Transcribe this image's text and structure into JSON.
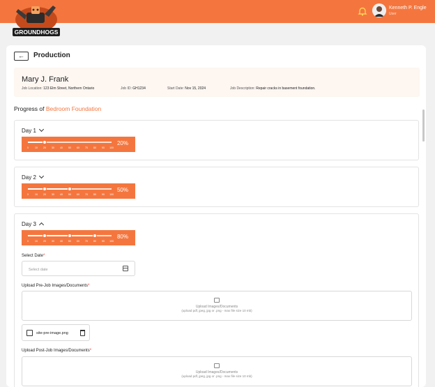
{
  "header": {
    "logo_text": "GROUNDHOGS",
    "user_name": "Kenneth P. Engle",
    "user_role": "User"
  },
  "page": {
    "back_label": "←",
    "title": "Production"
  },
  "job": {
    "customer_name": "Mary J. Frank",
    "location_label": "Job Location:",
    "location": "123 Elm Street, Northern Ontario",
    "id_label": "Job ID:",
    "id": "GH1234",
    "start_label": "Start Date:",
    "start": "Nov 15, 2024",
    "desc_label": "Job Description:",
    "desc": "Repair cracks in basement foundation."
  },
  "progress": {
    "prefix": "Progress of",
    "project": "Bedroom Foundation",
    "tick_labels": [
      "0",
      "10",
      "20",
      "30",
      "40",
      "50",
      "60",
      "70",
      "80",
      "90",
      "100"
    ],
    "days": [
      {
        "label": "Day 1",
        "percent_text": "20%",
        "markers": [
          20
        ],
        "expanded": false
      },
      {
        "label": "Day 2",
        "percent_text": "50%",
        "markers": [
          20,
          50
        ],
        "expanded": false
      },
      {
        "label": "Day 3",
        "percent_text": "80%",
        "markers": [
          20,
          50,
          80
        ],
        "expanded": true
      }
    ]
  },
  "day3_form": {
    "date_label": "Select Date",
    "date_placeholder": "Select date",
    "pre_label": "Upload Pre-Job Images/Documents",
    "upload_title": "Upload Images/Documents",
    "upload_hint": "(upload pdf, jpeg, jpg or .png - max file size 10 mb)",
    "pre_file": "site-pre-image.png",
    "post_label": "Upload Post-Job Images/Documents"
  },
  "colors": {
    "accent": "#f4763e",
    "required": "#e33333"
  }
}
